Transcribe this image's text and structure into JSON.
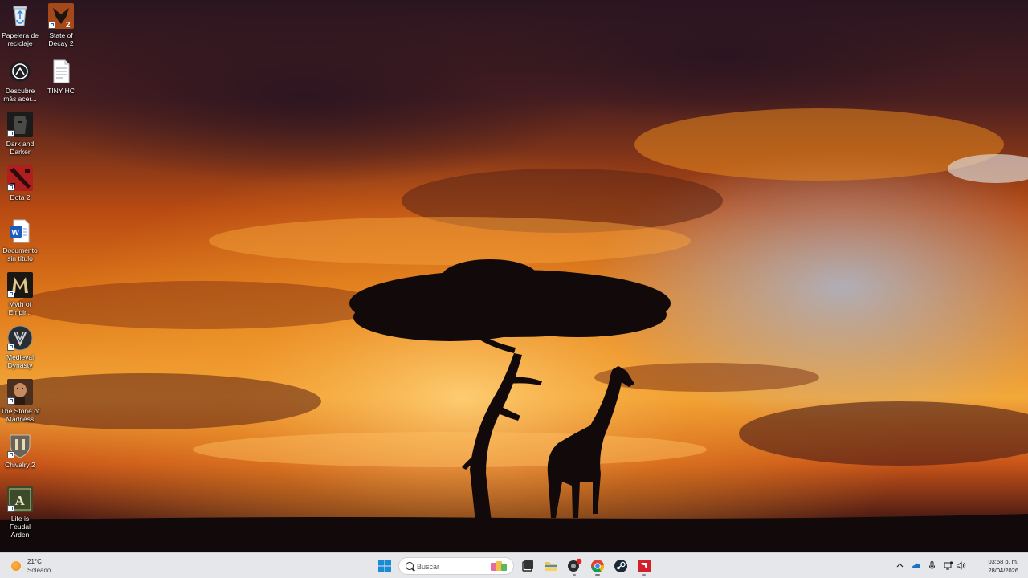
{
  "desktop": {
    "icons": [
      {
        "id": "recycle-bin",
        "label": "Papelera de reciclaje",
        "shortcut": false
      },
      {
        "id": "state-of-decay-2",
        "label": "State of Decay 2",
        "shortcut": true
      },
      {
        "id": "descubre",
        "label": "Descubre más acer...",
        "shortcut": false
      },
      {
        "id": "tiny-hc",
        "label": "TINY HC",
        "shortcut": false
      },
      {
        "id": "dark-and-darker",
        "label": "Dark and Darker",
        "shortcut": true
      },
      {
        "id": "dota-2",
        "label": "Dota 2",
        "shortcut": true
      },
      {
        "id": "documento",
        "label": "Documento sin título",
        "shortcut": false
      },
      {
        "id": "myth-of-empires",
        "label": "Myth of Empir...",
        "shortcut": true
      },
      {
        "id": "medieval-dynasty",
        "label": "Medieval Dynasty",
        "shortcut": true
      },
      {
        "id": "stone-of-madness",
        "label": "The Stone of Madness",
        "shortcut": true
      },
      {
        "id": "chivalry-2",
        "label": "Chivalry 2",
        "shortcut": true
      },
      {
        "id": "life-is-feudal",
        "label": "Life is Feudal Arden",
        "shortcut": true
      }
    ]
  },
  "taskbar": {
    "weather": {
      "temperature": "21°C",
      "condition": "Soleado",
      "icon": "sun-icon"
    },
    "search": {
      "placeholder": "Buscar"
    },
    "pinned": [
      {
        "name": "start",
        "icon": "windows-start-icon",
        "state": "none"
      },
      {
        "name": "task-view",
        "icon": "task-view-icon",
        "state": "none"
      },
      {
        "name": "file-explorer",
        "icon": "folder-icon",
        "state": "none"
      },
      {
        "name": "app-notification",
        "icon": "app-with-badge-icon",
        "state": "running"
      },
      {
        "name": "chrome",
        "icon": "chrome-icon",
        "state": "active"
      },
      {
        "name": "steam",
        "icon": "steam-icon",
        "state": "none"
      },
      {
        "name": "amd-software",
        "icon": "amd-icon",
        "state": "running"
      }
    ],
    "tray": {
      "icons": [
        "chevron-up-icon",
        "onedrive-icon",
        "microphone-icon",
        "network-icon",
        "volume-icon"
      ],
      "time": "03:58 p. m.",
      "date": "28/04/2026"
    }
  },
  "colors": {
    "taskbar_bg": "#e6e7ea",
    "accent_blue": "#0078d4",
    "sunset_orange": "#f08a12",
    "silhouette": "#120a0a"
  }
}
